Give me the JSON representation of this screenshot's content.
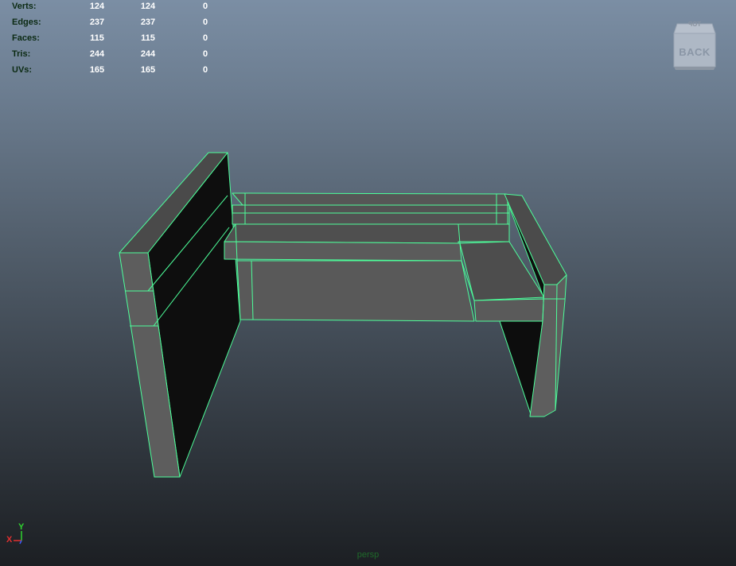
{
  "hud": {
    "rows": [
      {
        "label": "Verts:",
        "v1": "124",
        "v2": "124",
        "v3": "0"
      },
      {
        "label": "Edges:",
        "v1": "237",
        "v2": "237",
        "v3": "0"
      },
      {
        "label": "Faces:",
        "v1": "115",
        "v2": "115",
        "v3": "0"
      },
      {
        "label": "Tris:",
        "v1": "244",
        "v2": "244",
        "v3": "0"
      },
      {
        "label": "UVs:",
        "v1": "165",
        "v2": "165",
        "v3": "0"
      }
    ]
  },
  "viewcube": {
    "face_label": "BACK",
    "top_label": "TOP"
  },
  "axis": {
    "y_label": "Y",
    "x_label": "X"
  },
  "viewport": {
    "camera_label": "persp"
  },
  "colors": {
    "wireframe": "#4dff9a",
    "face_grey": "#5a5a5a",
    "face_dark": "#0d0d0d",
    "face_light": "#6a6a6a",
    "hud_label": "#0b2a12",
    "hud_value": "#ffffff",
    "axis_x": "#e23030",
    "axis_y": "#2fd32f",
    "axis_z": "#3a5bff"
  },
  "icons": {
    "viewcube": "viewcube-icon",
    "axis_gizmo": "axis-gizmo-icon"
  }
}
